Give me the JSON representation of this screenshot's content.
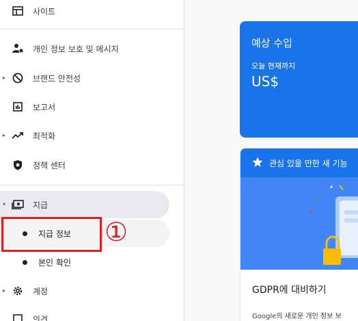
{
  "sidebar": {
    "items": [
      {
        "label": "사이트",
        "icon": "site-icon"
      },
      {
        "label": "개인 정보 보호 및 메시지",
        "icon": "privacy-icon"
      },
      {
        "label": "브랜드 안전성",
        "icon": "block-icon",
        "expandable": true
      },
      {
        "label": "보고서",
        "icon": "report-icon"
      },
      {
        "label": "최적화",
        "icon": "trending-icon",
        "expandable": true
      },
      {
        "label": "정책 센터",
        "icon": "shield-icon"
      },
      {
        "label": "지급",
        "icon": "payments-icon",
        "expanded": true
      },
      {
        "label": "계정",
        "icon": "gear-icon",
        "expandable": true
      },
      {
        "label": "의견",
        "icon": "feedback-icon"
      }
    ],
    "payments_sub": [
      {
        "label": "지급 정보",
        "active": true
      },
      {
        "label": "본인 확인"
      }
    ]
  },
  "annotation": {
    "marker": "①",
    "color": "#e11d1d"
  },
  "revenue_card": {
    "title": "예상 수입",
    "subtitle": "오늘 현재까지",
    "value": "US$"
  },
  "features_card": {
    "header": "관심 있을 만한 새 기능",
    "title": "GDPR에 대비하기",
    "desc": "Google의 새로운 개인 정보 보"
  },
  "colors": {
    "accent": "#1a73e8",
    "highlight": "#e11d1d"
  }
}
